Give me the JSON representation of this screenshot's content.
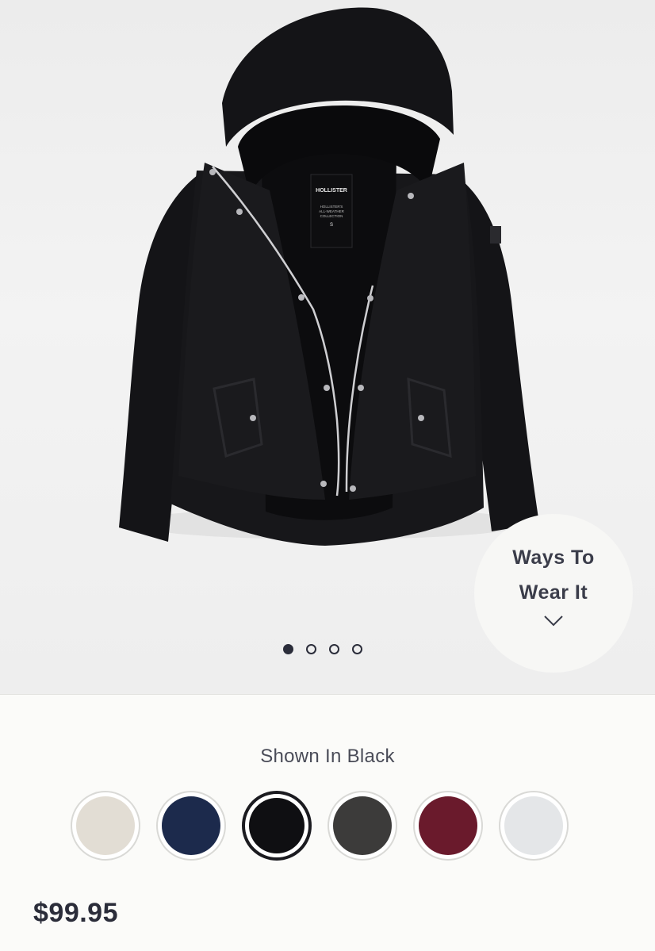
{
  "gallery": {
    "slides": 4,
    "active_slide": 1,
    "ways_to_wear_label": "Ways To Wear It",
    "jacket_tag": {
      "brand": "HOLLISTER",
      "lines": [
        "HOLLISTER'S",
        "ALL-WEATHER",
        "COLLECTION"
      ],
      "size": "S"
    }
  },
  "color_picker": {
    "shown_in_label": "Shown In Black",
    "selected_index": 2,
    "swatches": [
      {
        "color": "#e2ddd4"
      },
      {
        "color": "#1c2a4c"
      },
      {
        "color": "#0f0f12"
      },
      {
        "color": "#3c3b3a"
      },
      {
        "color": "#6a1a2c"
      },
      {
        "color": "#e4e6e8"
      }
    ]
  },
  "product": {
    "price": "$99.95"
  },
  "colors": {
    "text_dark": "#2b2d3a",
    "background": "#fbfbf9"
  }
}
